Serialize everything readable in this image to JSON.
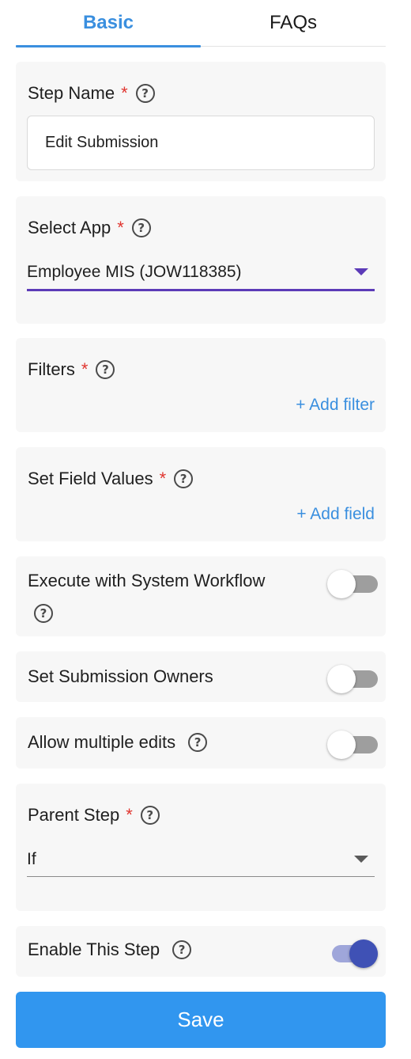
{
  "tabs": [
    {
      "label": "Basic",
      "active": true
    },
    {
      "label": "FAQs",
      "active": false
    }
  ],
  "step_name": {
    "label": "Step Name",
    "required_mark": "*",
    "help_glyph": "?",
    "value": "Edit Submission"
  },
  "select_app": {
    "label": "Select App",
    "required_mark": "*",
    "help_glyph": "?",
    "value": "Employee MIS (JOW118385)"
  },
  "filters": {
    "label": "Filters",
    "required_mark": "*",
    "help_glyph": "?",
    "add_label": "+ Add filter"
  },
  "set_field_values": {
    "label": "Set Field Values",
    "required_mark": "*",
    "help_glyph": "?",
    "add_label": "+ Add field"
  },
  "execute_system_workflow": {
    "label": "Execute with System Workflow",
    "help_glyph": "?",
    "enabled": false
  },
  "set_submission_owners": {
    "label": "Set Submission Owners",
    "enabled": false
  },
  "allow_multiple_edits": {
    "label": "Allow multiple edits",
    "help_glyph": "?",
    "enabled": false
  },
  "parent_step": {
    "label": "Parent Step",
    "required_mark": "*",
    "help_glyph": "?",
    "value": "If"
  },
  "enable_step": {
    "label": "Enable This Step",
    "help_glyph": "?",
    "enabled": true
  },
  "save_label": "Save",
  "colors": {
    "accent": "#3a8fdf",
    "save_button": "#3196ef",
    "required": "#e0352f",
    "select_underline_active": "#5c3bb8",
    "toggle_on": "#3f51b5",
    "card_bg": "#f7f7f7"
  },
  "icons": {
    "help": "question-circle-icon",
    "dropdown": "caret-down-icon"
  }
}
